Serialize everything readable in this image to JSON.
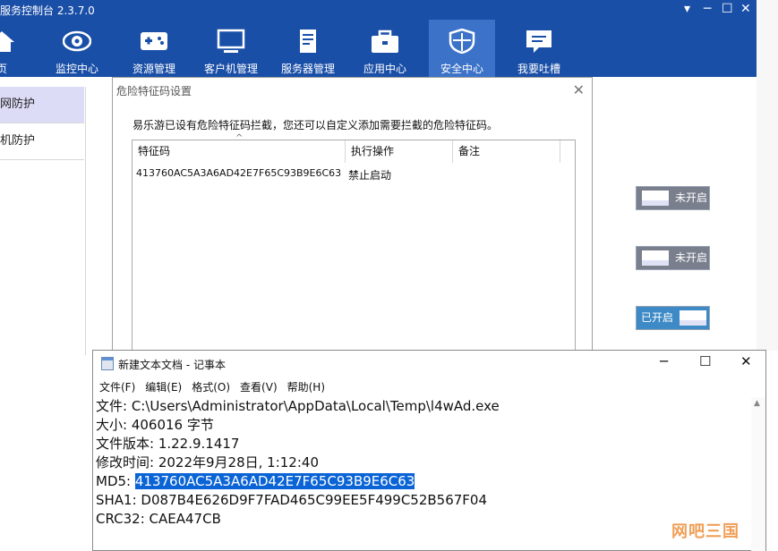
{
  "app": {
    "title": "服务控制台 2.3.7.0",
    "window_controls": [
      "▾",
      "─",
      "☐",
      "✕"
    ],
    "nav": [
      {
        "label": "页",
        "icon": "home-icon"
      },
      {
        "label": "监控中心",
        "icon": "eye-icon"
      },
      {
        "label": "资源管理",
        "icon": "gamepad-icon"
      },
      {
        "label": "客户机管理",
        "icon": "monitor-icon"
      },
      {
        "label": "服务器管理",
        "icon": "server-icon"
      },
      {
        "label": "应用中心",
        "icon": "toolbox-icon"
      },
      {
        "label": "安全中心",
        "icon": "shield-icon",
        "active": true
      },
      {
        "label": "我要吐槽",
        "icon": "chat-icon"
      }
    ],
    "sidebar": [
      {
        "label": "网防护",
        "active": true
      },
      {
        "label": "机防护",
        "active": false
      }
    ],
    "toggles": [
      {
        "label": "未开启",
        "state": "off"
      },
      {
        "label": "未开启",
        "state": "off"
      },
      {
        "label": "已开启",
        "state": "on"
      }
    ],
    "colors": {
      "header": "#1a4fa8",
      "active_nav": "#3c73c8",
      "toggle_on": "#3d8ac6",
      "toggle_off": "#7a7f8d"
    }
  },
  "dialog": {
    "title": "危险特征码设置",
    "close": "✕",
    "description": "易乐游已设有危险特征码拦截，您还可以自定义添加需要拦截的危险特征码。",
    "columns": [
      "特征码",
      "执行操作",
      "备注"
    ],
    "rows": [
      {
        "code": "413760AC5A3A6AD42E7F65C93B9E6C63",
        "action": "禁止启动",
        "note": ""
      }
    ]
  },
  "notepad": {
    "title": "新建文本文档 - 记事本",
    "controls": [
      "─",
      "☐",
      "✕"
    ],
    "menu": [
      "文件(F)",
      "编辑(E)",
      "格式(O)",
      "查看(V)",
      "帮助(H)"
    ],
    "lines": {
      "file": "文件: C:\\Users\\Administrator\\AppData\\Local\\Temp\\l4wAd.exe",
      "size": "大小: 406016 字节",
      "version": "文件版本: 1.22.9.1417",
      "modified": "修改时间: 2022年9月28日, 1:12:40",
      "md5_label": "MD5: ",
      "md5_value": "413760AC5A3A6AD42E7F65C93B9E6C63",
      "sha1": "SHA1: D087B4E626D9F7FAD465C99EE5F499C52B567F04",
      "crc32": "CRC32: CAEA47CB"
    }
  },
  "watermark": "网吧三国"
}
